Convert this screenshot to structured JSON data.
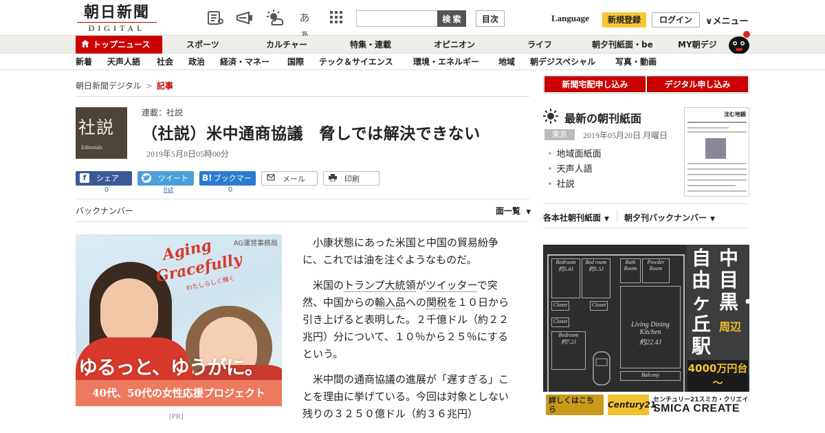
{
  "header": {
    "logo_main": "朝日新聞",
    "logo_sub": "DIGITAL",
    "icons": [
      "newspaper-icon",
      "megaphone-icon",
      "weather-icon",
      "font-size-icon",
      "grid-icon"
    ],
    "font_size_glyph": "あぁ",
    "search_placeholder": "",
    "search_button": "検 索",
    "toc_button": "目次",
    "language": "Language",
    "signup": "新規登録",
    "login": "ログイン",
    "menu": "∨メニュー"
  },
  "nav_primary": {
    "active": "トップニュース",
    "items": [
      "スポーツ",
      "カルチャー",
      "特集・連載",
      "オピニオン",
      "ライフ",
      "朝夕刊紙面・be",
      "MY朝デジ"
    ]
  },
  "nav_secondary": {
    "items": [
      "新着",
      "天声人語",
      "社会",
      "政治",
      "経済・マネー",
      "国際",
      "テック＆サイエンス",
      "環境・エネルギー",
      "地域",
      "朝デジスペシャル",
      "写真・動画"
    ]
  },
  "breadcrumb": {
    "home": "朝日新聞デジタル",
    "separator": ">",
    "current": "記事"
  },
  "article": {
    "tag_kanji": "社説",
    "tag_english": "Editorials",
    "series": "連載：社説",
    "headline": "（社説）米中通商協議　脅しでは解決できない",
    "date": "2019年5月8日05時00分",
    "share": {
      "facebook_label": "シェア",
      "facebook_count": "0",
      "twitter_label": "ツイート",
      "twitter_count": "list",
      "hatena_label": "ブックマーク",
      "hatena_glyph": "B!",
      "hatena_count": "0",
      "mail_label": "メール",
      "print_label": "印刷"
    },
    "back_number": "バックナンバー",
    "page_list": "面一覧",
    "paragraphs": [
      "小康状態にあった米国と中国の貿易紛争に、これでは油を注ぐようなものだ。",
      "米国の{トランプ大統領}が{ツイッター}で突然、中国からの{輸入品}への{関税}を１０日から引き上げると表明した。２千億ドル（約２２兆円）分について、１０％から２５％にするという。",
      "米中間の通商協議の進展が「遅すぎる」ことを理由に挙げている。今回は対象としない残りの３２５０億ドル（約３６兆円）"
    ]
  },
  "ad_left": {
    "agency": "AG運営事務局",
    "title_line1": "Aging",
    "title_line2": "Gracefully",
    "title_sub": "わたしらしく輝く",
    "catch": "ゆるっと、ゆうがに。",
    "band": "40代、50代の女性応援プロジェクト",
    "pr_label": "[PR]"
  },
  "sidebar": {
    "delivery_button": "新聞宅配申し込み",
    "digital_button": "デジタル申し込み",
    "newspaper_title": "最新の朝刊紙面",
    "city": "東京",
    "newspaper_date": "2019年05月20日 月曜日",
    "links": [
      "地域面紙面",
      "天声人語",
      "社説"
    ],
    "thumb_headline": "沈む地銀",
    "dropdown_morning": "各本社朝刊紙面",
    "dropdown_back": "朝夕刊バックナンバー"
  },
  "ad_right": {
    "rooms": [
      "Bedroom",
      "Bed room",
      "Bath Room",
      "Powder Room",
      "Closet",
      "Closet",
      "Closet",
      "Bedroom",
      "Living Dining Kitchen",
      "Balcony"
    ],
    "room_sizes": [
      "約5.4J",
      "約5.5J",
      "約7.2J",
      "約22.4J"
    ],
    "headline_col1": "自由ヶ丘駅",
    "headline_col2": "中目黒・",
    "headline_col2_sub": "周辺",
    "price": "4000万円台～",
    "detail_button": "詳しくはこちら",
    "brand_logo": "Century21",
    "brand_top": "センチュリー21スミカ・クリエイト",
    "brand_main": "SMICA CREATE"
  }
}
